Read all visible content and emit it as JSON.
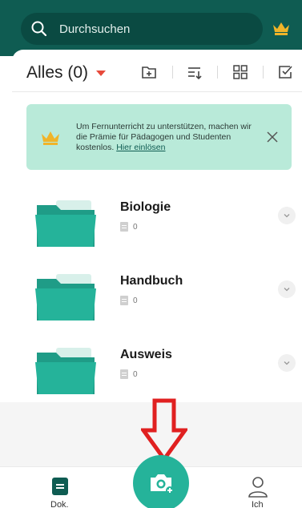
{
  "search": {
    "placeholder": "Durchsuchen"
  },
  "toolbar": {
    "title": "Alles (0)"
  },
  "banner": {
    "text": "Um Fernunterricht zu unterstützen, machen wir die Prämie für Pädagogen und Studenten kostenlos.",
    "link": "Hier einlösen"
  },
  "folders": [
    {
      "name": "Biologie",
      "count": "0"
    },
    {
      "name": "Handbuch",
      "count": "0"
    },
    {
      "name": "Ausweis",
      "count": "0"
    }
  ],
  "nav": {
    "documents": "Dok.",
    "me": "Ich"
  },
  "colors": {
    "header": "#0f5c52",
    "accent": "#25b39a",
    "banner": "#b9ead9",
    "crown": "#f0b429",
    "arrow": "#e02020"
  }
}
